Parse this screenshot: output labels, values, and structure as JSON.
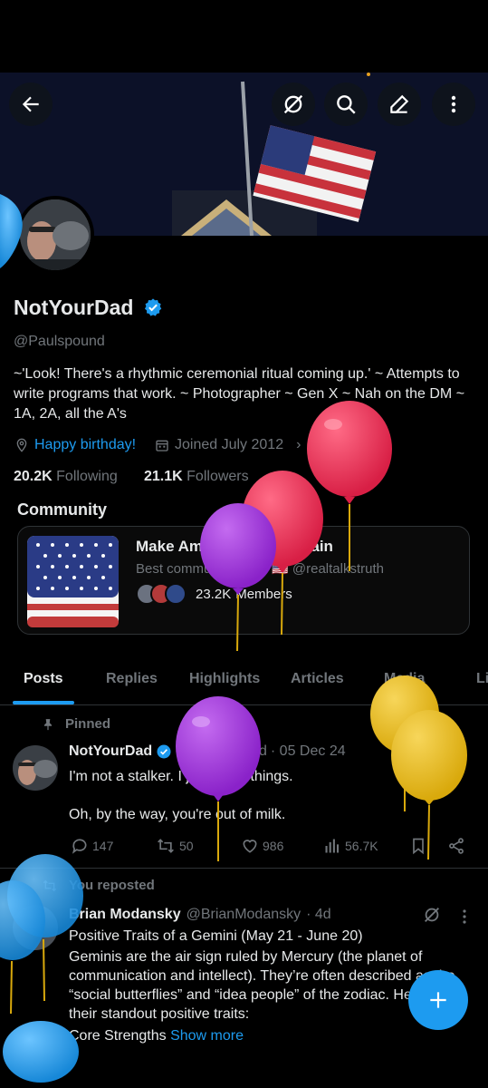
{
  "header": {
    "back_icon": "arrow-left-icon",
    "grok_icon": "grok-icon",
    "search_icon": "search-icon",
    "edit_icon": "pencil-icon",
    "more_icon": "more-vertical-icon"
  },
  "profile": {
    "display_name": "NotYourDad",
    "verified": true,
    "handle": "@Paulspound",
    "bio": "~'Look! There's a rhythmic ceremonial ritual coming up.' ~ Attempts to write programs that work. ~ Photographer ~ Gen X ~ Nah on the DM ~ 1A, 2A, all the A's",
    "birthday_text": "Happy birthday!",
    "joined_text": "Joined July 2012",
    "following_count": "20.2K",
    "following_label": "Following",
    "followers_count": "21.1K",
    "followers_label": "Followers"
  },
  "community": {
    "section_title": "Community",
    "name": "Make America Godly Again",
    "description": "Best community on X! 🇺🇸 @realtalkstruth",
    "members_count": "23.2K",
    "members_label": "Members"
  },
  "tabs": [
    {
      "label": "Posts",
      "active": true
    },
    {
      "label": "Replies"
    },
    {
      "label": "Highlights"
    },
    {
      "label": "Articles"
    },
    {
      "label": "Media"
    },
    {
      "label": "Li"
    }
  ],
  "posts": [
    {
      "context": "Pinned",
      "author": "NotYourDad",
      "handle": "@Paulspound",
      "date": "· 05 Dec 24",
      "text_line1": "I'm not a stalker. I just know things.",
      "text_line2": "Oh, by the way, you're out of milk.",
      "replies": "147",
      "reposts": "50",
      "likes": "986",
      "views": "56.7K"
    },
    {
      "context": "You reposted",
      "author": "Brian Modansky",
      "handle": "@BrianModansky",
      "date": "· 4d",
      "title": "Positive Traits of a Gemini (May 21 - June 20)",
      "body": "Geminis are the air sign ruled by Mercury (the planet of communication and intellect). They’re often described as the “social butterflies” and “idea people” of the zodiac. Here are their standout positive traits:",
      "last_line": "Core Strengths",
      "show_more": "Show more"
    }
  ],
  "colors": {
    "accent": "#1d9bf0",
    "background": "#000000",
    "secondary_text": "#71767b",
    "balloon_red": "#e8294f",
    "balloon_purple": "#9b30d9",
    "balloon_yellow": "#e6b712",
    "balloon_blue": "#1d9bf0"
  }
}
